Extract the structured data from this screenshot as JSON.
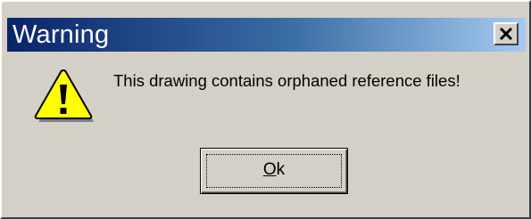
{
  "dialog": {
    "title": "Warning",
    "message": "This drawing contains orphaned reference files!",
    "icon": "warning-icon",
    "close_icon": "close-icon",
    "ok_button": {
      "mnemonic": "O",
      "rest": "k"
    }
  },
  "colors": {
    "face": "#d4d0c8",
    "title_gradient_start": "#0a246a",
    "title_gradient_end": "#a6caf0",
    "warning_yellow": "#ffff00"
  }
}
